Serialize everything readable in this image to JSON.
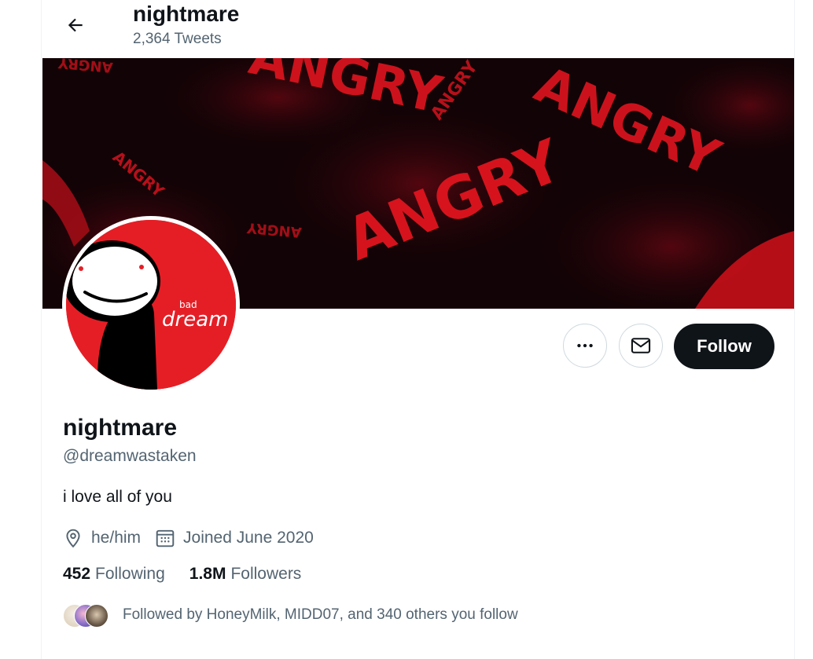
{
  "header": {
    "title": "nightmare",
    "tweet_count": "2,364 Tweets"
  },
  "banner": {
    "words": [
      "ANGRY",
      "ANGRY",
      "ANGRY",
      "ANGRY",
      "ANGRY",
      "ANGRY",
      "ANGRY"
    ]
  },
  "avatar": {
    "small_text": "bad",
    "big_text": "dream"
  },
  "actions": {
    "more_icon": "more-horizontal-icon",
    "message_icon": "envelope-icon",
    "follow_label": "Follow"
  },
  "profile": {
    "display_name": "nightmare",
    "handle": "@dreamwastaken",
    "bio": "i love all of you",
    "location": "he/him",
    "location_icon": "location-pin-icon",
    "joined": "Joined June 2020",
    "joined_icon": "calendar-icon"
  },
  "stats": {
    "following_count": "452",
    "following_label": "Following",
    "followers_count": "1.8M",
    "followers_label": "Followers"
  },
  "followed_by": {
    "text": "Followed by HoneyMilk, MIDD07, and 340 others you follow"
  },
  "colors": {
    "accent_dark": "#0f1419",
    "secondary_text": "#536471",
    "banner_red": "#e0141f",
    "avatar_red": "#e51e26"
  }
}
